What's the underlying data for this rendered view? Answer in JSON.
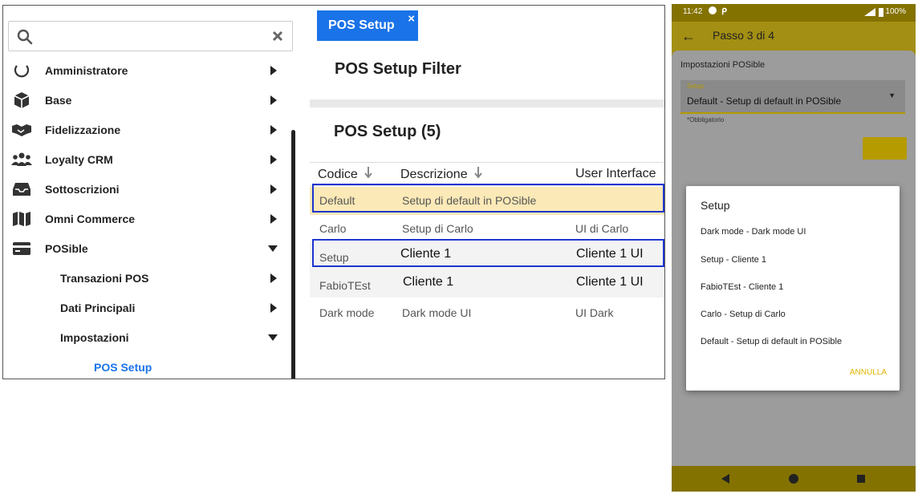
{
  "search": {
    "value": "",
    "placeholder": ""
  },
  "menu": {
    "items": [
      {
        "label": "Amministratore",
        "icon": "circle-icon"
      },
      {
        "label": "Base",
        "icon": "box-icon"
      },
      {
        "label": "Fidelizzazione",
        "icon": "handshake-icon"
      },
      {
        "label": "Loyalty CRM",
        "icon": "users-icon"
      },
      {
        "label": "Sottoscrizioni",
        "icon": "inbox-icon"
      },
      {
        "label": "Omni Commerce",
        "icon": "map-icon"
      },
      {
        "label": "POSible",
        "icon": "credit-card-icon"
      }
    ],
    "subitems": [
      {
        "label": "Transazioni POS"
      },
      {
        "label": "Dati Principali"
      },
      {
        "label": "Impostazioni"
      }
    ],
    "active": "POS Setup"
  },
  "tab": {
    "label": "POS Setup",
    "close": "×"
  },
  "filter_title": "POS Setup Filter",
  "setup_title": "POS Setup (5)",
  "table": {
    "headers": [
      "Codice",
      "Descrizione",
      "User Interface"
    ],
    "rows": [
      {
        "code": "Default",
        "desc": "Setup di default in POSible",
        "ui": ""
      },
      {
        "code": "Carlo",
        "desc": "Setup di Carlo",
        "ui": "UI di Carlo"
      },
      {
        "code": "Setup",
        "desc": "Cliente 1",
        "ui": "Cliente 1 UI"
      },
      {
        "code": "FabioTEst",
        "desc": "Cliente 1",
        "ui": "Cliente 1 UI"
      },
      {
        "code": "Dark mode",
        "desc": "Dark mode UI",
        "ui": "UI Dark"
      }
    ]
  },
  "phone": {
    "status_time": "11:42",
    "status_battery": "100%",
    "app_title": "Passo 3 di 4",
    "section": "Impostazioni POSible",
    "select_label": "Setup",
    "select_value": "Default - Setup di default in POSible",
    "required": "*Obbligatorio",
    "dialog": {
      "title": "Setup",
      "options": [
        "Dark mode - Dark mode UI",
        "Setup - Cliente 1",
        "FabioTEst - Cliente 1",
        "Carlo - Setup di Carlo",
        "Default - Setup di default in POSible"
      ],
      "cancel": "ANNULLA"
    }
  },
  "colors": {
    "accent": "#1a73e8",
    "highlight_row": "#fbe9b7",
    "outline": "#1d35d0",
    "phone_primary": "#b59a00"
  }
}
